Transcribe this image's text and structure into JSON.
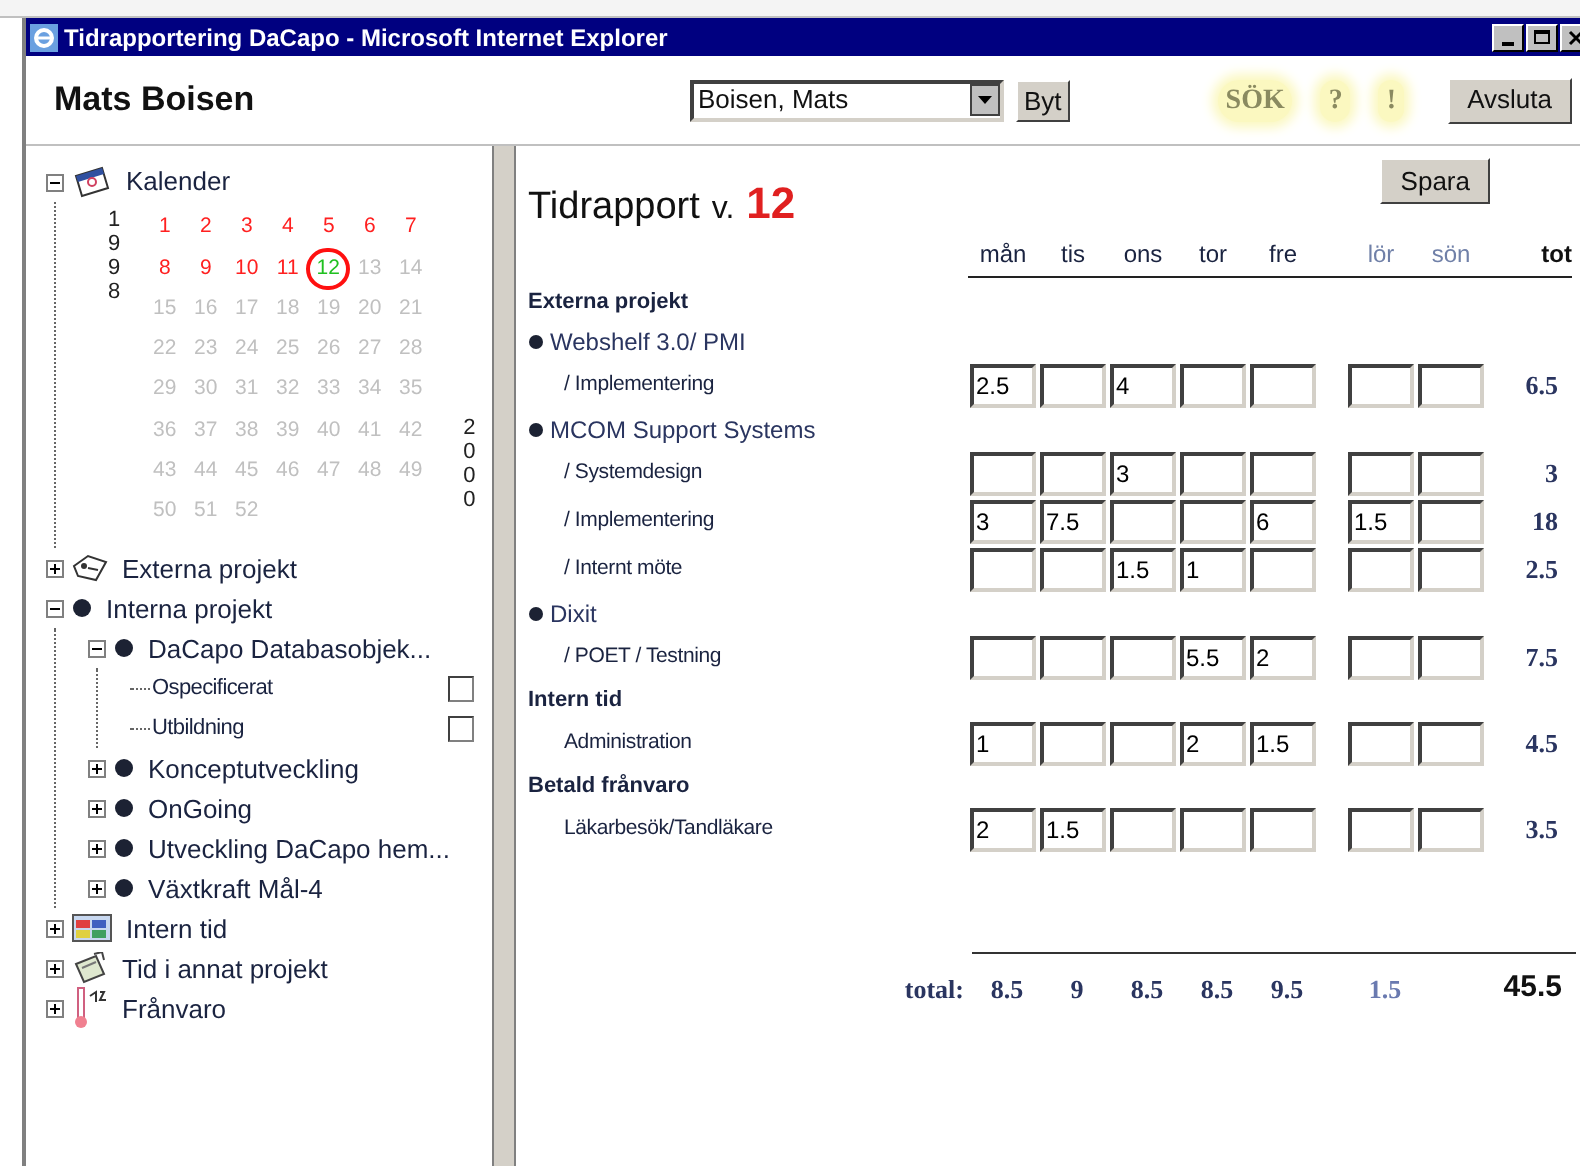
{
  "window": {
    "title": "Tidrapportering DaCapo - Microsoft Internet Explorer"
  },
  "header": {
    "user_name": "Mats Boisen",
    "user_select": {
      "value": "Boisen, Mats"
    },
    "switch_button": "Byt",
    "links": [
      "SÖK",
      "?",
      "!"
    ],
    "logout_button": "Avsluta"
  },
  "calendar": {
    "label": "Kalender",
    "expanded": true,
    "year_start": "1998",
    "year_end": "2000",
    "weeks": [
      {
        "label": "1",
        "kind": "reported"
      },
      {
        "label": "2",
        "kind": "reported"
      },
      {
        "label": "3",
        "kind": "reported"
      },
      {
        "label": "4",
        "kind": "reported"
      },
      {
        "label": "5",
        "kind": "reported"
      },
      {
        "label": "6",
        "kind": "reported"
      },
      {
        "label": "7",
        "kind": "reported"
      },
      {
        "label": "8",
        "kind": "reported"
      },
      {
        "label": "9",
        "kind": "reported"
      },
      {
        "label": "10",
        "kind": "reported"
      },
      {
        "label": "11",
        "kind": "reported"
      },
      {
        "label": "12",
        "kind": "current"
      },
      {
        "label": "13",
        "kind": "open"
      },
      {
        "label": "14",
        "kind": "open"
      },
      {
        "label": "15",
        "kind": "open"
      },
      {
        "label": "16",
        "kind": "open"
      },
      {
        "label": "17",
        "kind": "open"
      },
      {
        "label": "18",
        "kind": "open"
      },
      {
        "label": "19",
        "kind": "open"
      },
      {
        "label": "20",
        "kind": "open"
      },
      {
        "label": "21",
        "kind": "open"
      },
      {
        "label": "22",
        "kind": "open"
      },
      {
        "label": "23",
        "kind": "open"
      },
      {
        "label": "24",
        "kind": "open"
      },
      {
        "label": "25",
        "kind": "open"
      },
      {
        "label": "26",
        "kind": "open"
      },
      {
        "label": "27",
        "kind": "open"
      },
      {
        "label": "28",
        "kind": "open"
      },
      {
        "label": "29",
        "kind": "open"
      },
      {
        "label": "30",
        "kind": "open"
      },
      {
        "label": "31",
        "kind": "open"
      },
      {
        "label": "32",
        "kind": "open"
      },
      {
        "label": "33",
        "kind": "open"
      },
      {
        "label": "34",
        "kind": "open"
      },
      {
        "label": "35",
        "kind": "open"
      },
      {
        "label": "36",
        "kind": "open"
      },
      {
        "label": "37",
        "kind": "open"
      },
      {
        "label": "38",
        "kind": "open"
      },
      {
        "label": "39",
        "kind": "open"
      },
      {
        "label": "40",
        "kind": "open"
      },
      {
        "label": "41",
        "kind": "open"
      },
      {
        "label": "42",
        "kind": "open"
      },
      {
        "label": "43",
        "kind": "open"
      },
      {
        "label": "44",
        "kind": "open"
      },
      {
        "label": "45",
        "kind": "open"
      },
      {
        "label": "46",
        "kind": "open"
      },
      {
        "label": "47",
        "kind": "open"
      },
      {
        "label": "48",
        "kind": "open"
      },
      {
        "label": "49",
        "kind": "open"
      },
      {
        "label": "50",
        "kind": "open"
      },
      {
        "label": "51",
        "kind": "open"
      },
      {
        "label": "52",
        "kind": "open"
      }
    ]
  },
  "tree": [
    {
      "label": "Externa projekt",
      "kind": "tag",
      "expanded": false
    },
    {
      "label": "Interna projekt",
      "kind": "ball",
      "expanded": true,
      "children": [
        {
          "label": "DaCapo Databasobjek...",
          "kind": "ball",
          "expanded": true,
          "children": [
            {
              "label": "Ospecificerat",
              "kind": "task",
              "checked": false
            },
            {
              "label": "Utbildning",
              "kind": "task",
              "checked": false
            }
          ]
        },
        {
          "label": "Konceptutveckling",
          "kind": "ball",
          "expanded": false
        },
        {
          "label": "OnGoing",
          "kind": "ball",
          "expanded": false
        },
        {
          "label": "Utveckling DaCapo hem...",
          "kind": "ball",
          "expanded": false
        },
        {
          "label": "Växtkraft Mål-4",
          "kind": "ball",
          "expanded": false
        }
      ]
    },
    {
      "label": "Intern tid",
      "kind": "grid",
      "expanded": false
    },
    {
      "label": "Tid i annat projekt",
      "kind": "notepad",
      "expanded": false
    },
    {
      "label": "Frånvaro",
      "kind": "thermometer",
      "expanded": false
    }
  ],
  "report": {
    "title": "Tidrapport",
    "week_prefix": "v.",
    "week": "12",
    "save_button": "Spara",
    "days": [
      {
        "label": "mån",
        "weekend": false
      },
      {
        "label": "tis",
        "weekend": false
      },
      {
        "label": "ons",
        "weekend": false
      },
      {
        "label": "tor",
        "weekend": false
      },
      {
        "label": "fre",
        "weekend": false
      },
      {
        "label": "lör",
        "weekend": true
      },
      {
        "label": "sön",
        "weekend": true
      }
    ],
    "total_header": "tot",
    "rows": [
      {
        "kind": "section",
        "label": "Externa projekt"
      },
      {
        "kind": "project",
        "label": "Webshelf 3.0/ PMI"
      },
      {
        "kind": "task",
        "label": "/ Implementering",
        "cells": [
          {
            "value": "2.5"
          },
          {},
          {
            "value": "4"
          },
          {},
          {},
          {},
          {}
        ],
        "total": "6.5"
      },
      {
        "kind": "project",
        "label": "MCOM Support Systems"
      },
      {
        "kind": "task",
        "label": "/ Systemdesign",
        "cells": [
          {},
          {},
          {
            "value": "3"
          },
          {},
          {},
          {},
          {}
        ],
        "total": "3"
      },
      {
        "kind": "task",
        "label": "/ Implementering",
        "cells": [
          {
            "value": "3"
          },
          {
            "value": "7.5"
          },
          {},
          {},
          {
            "value": "6"
          },
          {
            "value": "1.5"
          },
          {}
        ],
        "total": "18"
      },
      {
        "kind": "task",
        "label": "/ Internt möte",
        "cells": [
          {},
          {},
          {
            "value": "1.5"
          },
          {
            "value": "1"
          },
          {},
          {},
          {}
        ],
        "total": "2.5"
      },
      {
        "kind": "project",
        "label": "Dixit"
      },
      {
        "kind": "task",
        "label": "/ POET / Testning",
        "cells": [
          {},
          {},
          {},
          {
            "value": "5.5"
          },
          {
            "value": "2"
          },
          {},
          {}
        ],
        "total": "7.5"
      },
      {
        "kind": "section",
        "label": "Intern tid"
      },
      {
        "kind": "task",
        "label": "Administration",
        "cells": [
          {
            "value": "1"
          },
          {},
          {},
          {
            "value": "2"
          },
          {
            "value": "1.5"
          },
          {},
          {}
        ],
        "total": "4.5"
      },
      {
        "kind": "section",
        "label": "Betald frånvaro"
      },
      {
        "kind": "task",
        "label": "Läkarbesök/Tandläkare",
        "cells": [
          {
            "value": "2"
          },
          {
            "value": "1.5"
          },
          {},
          {},
          {},
          {},
          {}
        ],
        "total": "3.5"
      }
    ],
    "totals": {
      "label": "total:",
      "days": [
        {
          "value": "8.5"
        },
        {
          "value": "9"
        },
        {
          "value": "8.5"
        },
        {
          "value": "8.5"
        },
        {
          "value": "9.5"
        },
        {
          "value": "1.5"
        }
      ],
      "grand_total": "45.5"
    }
  }
}
